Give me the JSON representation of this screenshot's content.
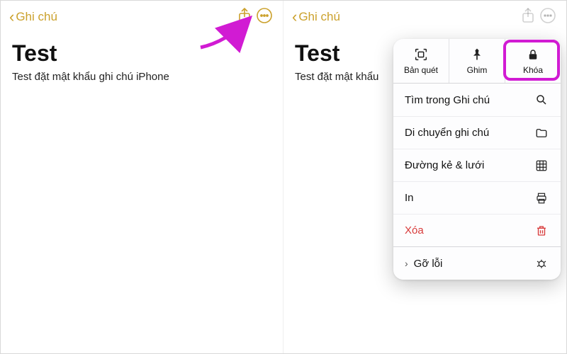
{
  "accent": "#cba12c",
  "highlight": "#d11bd3",
  "left": {
    "back_label": "Ghi chú",
    "title": "Test",
    "body": "Test đặt mật khẩu ghi chú iPhone"
  },
  "right": {
    "back_label": "Ghi chú",
    "title": "Test",
    "body": "Test đặt mật khẩu",
    "sheet": {
      "top": [
        {
          "label": "Bản quét",
          "icon": "scan-icon"
        },
        {
          "label": "Ghim",
          "icon": "pin-icon"
        },
        {
          "label": "Khóa",
          "icon": "lock-icon"
        }
      ],
      "list": [
        {
          "label": "Tìm trong Ghi chú",
          "icon": "search-icon"
        },
        {
          "label": "Di chuyển ghi chú",
          "icon": "folder-icon"
        },
        {
          "label": "Đường kẻ & lưới",
          "icon": "grid-icon"
        },
        {
          "label": "In",
          "icon": "print-icon"
        },
        {
          "label": "Xóa",
          "icon": "trash-icon",
          "destructive": true
        }
      ],
      "more": {
        "label": "Gỡ lỗi",
        "icon": "bug-icon"
      }
    }
  }
}
